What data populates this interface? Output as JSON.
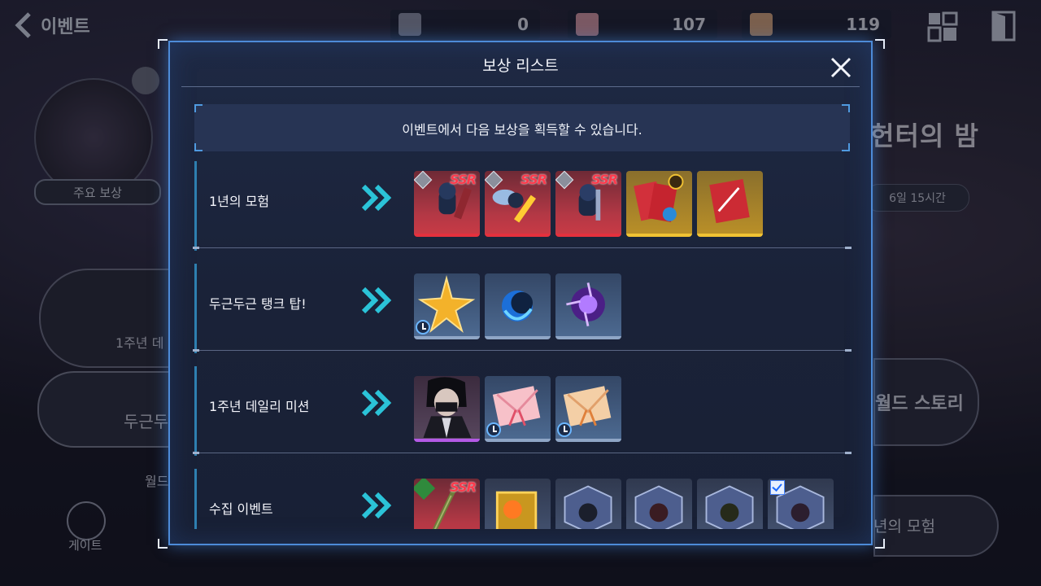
{
  "header": {
    "back_label": "이벤트",
    "resources": [
      {
        "icon": "ticket-icon",
        "value": "0"
      },
      {
        "icon": "pink-envelope-icon",
        "value": "107"
      },
      {
        "icon": "orange-envelope-icon",
        "value": "119"
      }
    ]
  },
  "background": {
    "main_reward_label": "주요 보상",
    "left_card1_label": "1주년 데",
    "left_card2_label": "두근두",
    "left_sub_label": "월드",
    "gate_label": "게이트",
    "right_title": "헌터의 밤",
    "right_timer": "6일 15시간",
    "right_story_label": "월드 스토리",
    "right_adv_label": "년의 모험"
  },
  "modal": {
    "title": "보상 리스트",
    "notice": "이벤트에서 다음 보상을 획득할 수 있습니다.",
    "rows": [
      {
        "label": "1년의 모험",
        "items": [
          {
            "name": "ssr-figure-reward",
            "frame": "red",
            "badge_text": "SSR"
          },
          {
            "name": "ssr-fairy-reward",
            "frame": "red",
            "badge_text": "SSR"
          },
          {
            "name": "ssr-figure-reward-2",
            "frame": "red",
            "badge_text": "SSR"
          },
          {
            "name": "card-pack-reward",
            "frame": "gold",
            "badge_text": ""
          },
          {
            "name": "red-card-reward",
            "frame": "gold",
            "badge_text": ""
          }
        ]
      },
      {
        "label": "두근두근 탱크 탑!",
        "items": [
          {
            "name": "gold-star-reward",
            "frame": "blue",
            "badge_text": ""
          },
          {
            "name": "blue-orb-reward",
            "frame": "blue",
            "badge_text": ""
          },
          {
            "name": "purple-orb-reward",
            "frame": "blue",
            "badge_text": ""
          }
        ]
      },
      {
        "label": "1주년 데일리 미션",
        "items": [
          {
            "name": "hunter-portrait-reward",
            "frame": "purple",
            "badge_text": ""
          },
          {
            "name": "pink-envelope-reward",
            "frame": "blue",
            "badge_text": ""
          },
          {
            "name": "orange-envelope-reward",
            "frame": "blue",
            "badge_text": ""
          }
        ]
      },
      {
        "label": "수집 이벤트",
        "items": [
          {
            "name": "ssr-weapon-reward",
            "frame": "red",
            "badge_text": "SSR"
          },
          {
            "name": "gold-box-reward",
            "frame": "dark",
            "badge_text": ""
          },
          {
            "name": "cube-box-reward-1",
            "frame": "dark",
            "badge_text": ""
          },
          {
            "name": "cube-box-reward-2",
            "frame": "dark",
            "badge_text": ""
          },
          {
            "name": "cube-box-reward-3",
            "frame": "dark",
            "badge_text": ""
          },
          {
            "name": "cube-box-reward-4",
            "frame": "dark",
            "badge_text": ""
          }
        ]
      }
    ]
  },
  "colors": {
    "modal_border": "#4d8bd8",
    "ssr_red": "#ff3a4c",
    "gold_frame": "#f1c233",
    "chevron": "#2bc3d8"
  }
}
